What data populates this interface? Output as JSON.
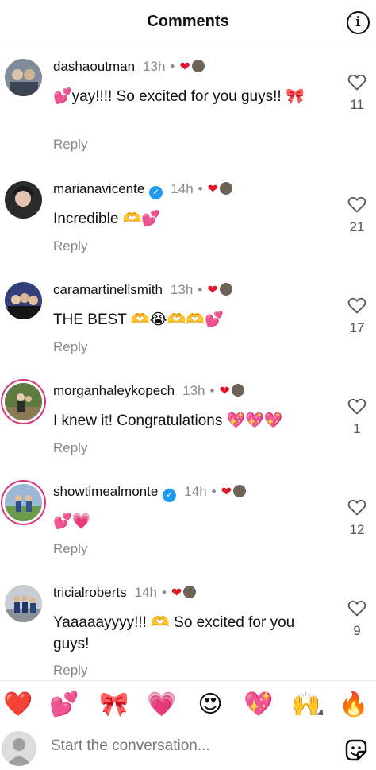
{
  "header": {
    "title": "Comments",
    "info_icon": "info-circle-icon",
    "info_glyph": "i"
  },
  "glyphs": {
    "dot": "•",
    "liked": "❤",
    "verified": "✓"
  },
  "comments": [
    {
      "username": "dashaoutman",
      "verified": false,
      "time": "13h",
      "text": "💕yay!!!! So excited for you guys!! 🎀",
      "reply": "Reply",
      "likes": "11"
    },
    {
      "username": "marianavicente",
      "verified": true,
      "time": "14h",
      "text": "Incredible 🫶💕",
      "reply": "Reply",
      "likes": "21"
    },
    {
      "username": "caramartinellsmith",
      "verified": false,
      "time": "13h",
      "text": "THE BEST 🫶😭🫶🫶💕",
      "reply": "Reply",
      "likes": "17"
    },
    {
      "username": "morganhaleykopech",
      "verified": false,
      "time": "13h",
      "text": "I knew it! Congratulations 💖💖💖",
      "reply": "Reply",
      "likes": "1"
    },
    {
      "username": "showtimealmonte",
      "verified": true,
      "time": "14h",
      "text": "💕💗",
      "reply": "Reply",
      "likes": "12"
    },
    {
      "username": "tricialroberts",
      "verified": false,
      "time": "14h",
      "text": "Yaaaaayyyy!!! 🫶 So excited for you guys!",
      "reply": "Reply",
      "likes": "9"
    }
  ],
  "reactions": [
    "❤️",
    "💕",
    "🎀",
    "💗",
    "😍",
    "💖",
    "🙌",
    "🔥"
  ],
  "composer": {
    "placeholder": "Start the conversation..."
  },
  "colors": {
    "liked_heart": "#e0162b",
    "verified_badge": "#1d9bf0",
    "story_ring": "#d8347a",
    "muted_text": "#8a8a8a"
  }
}
